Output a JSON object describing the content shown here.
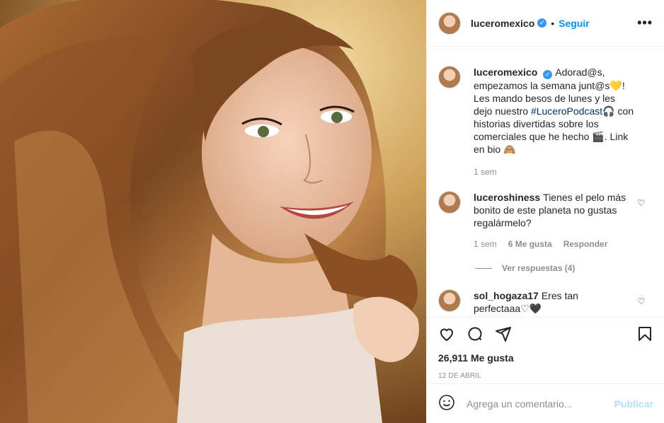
{
  "post": {
    "username": "luceromexico",
    "follow_label": "Seguir",
    "caption_part1": "Adorad@s, empezamos la semana junt@s",
    "caption_emoji_heart": "💛",
    "caption_part2": "! Les mando besos de lunes y les dejo nuestro ",
    "hashtag": "#LuceroPodcast",
    "caption_emoji_headphones": "🎧",
    "caption_part3": " con historias divertidas sobre los comerciales que he hecho ",
    "caption_emoji_clapper": "🎬",
    "caption_part4": ". Link en bio ",
    "caption_emoji_face": "🙈",
    "caption_time": "1 sem"
  },
  "comments": [
    {
      "username": "luceroshiness",
      "text": "Tienes el pelo más bonito de este planeta no gustas regalármelo?",
      "time": "1 sem",
      "likes": "6 Me gusta",
      "reply": "Responder",
      "replies_label": "Ver respuestas (4)"
    },
    {
      "username": "sol_hogaza17",
      "text": "Eres tan perfectaaa♡🖤"
    }
  ],
  "likes_count": "26,911 Me gusta",
  "date": "12 DE ABRIL",
  "add_comment": {
    "placeholder": "Agrega un comentario...",
    "publish_label": "Publicar"
  },
  "colors": {
    "accent": "#0095f6",
    "hashtag": "#00376b",
    "muted": "#8e8e8e",
    "verified": "#3897f0",
    "publish_disabled": "#b2dffc"
  },
  "icons": [
    "verified-badge-icon",
    "more-options-icon",
    "heart-icon",
    "comment-icon",
    "share-icon",
    "bookmark-icon",
    "emoji-icon"
  ]
}
